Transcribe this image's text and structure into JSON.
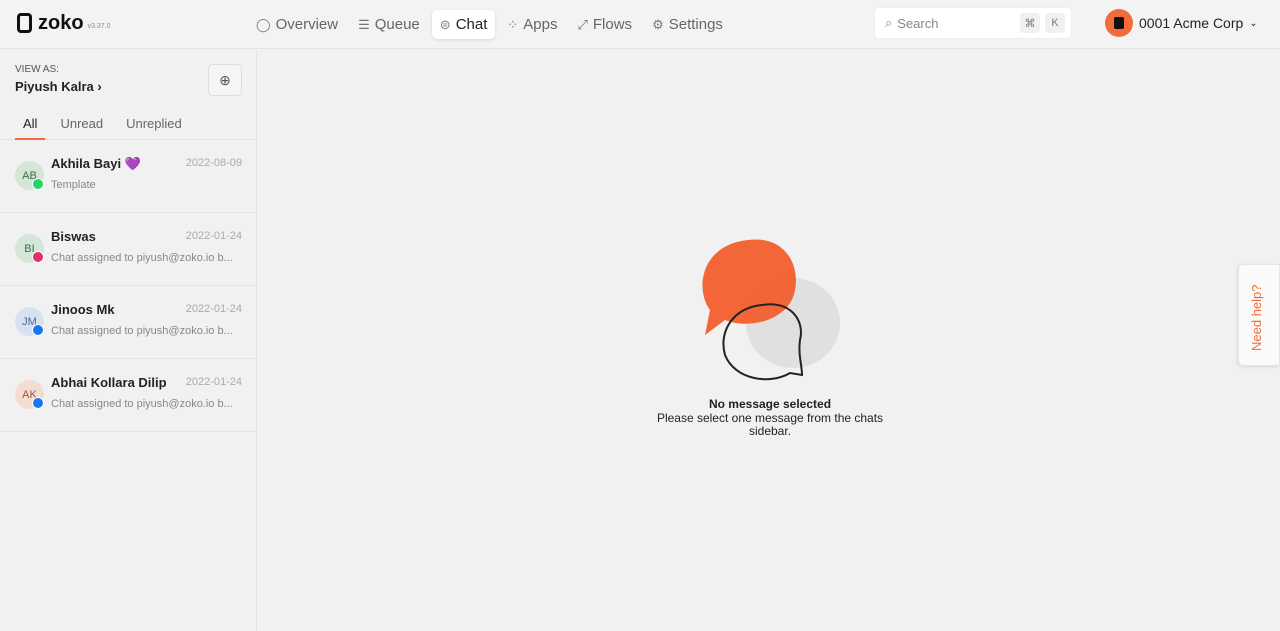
{
  "header": {
    "logo": "zoko",
    "version": "v3.37.0",
    "nav": [
      {
        "label": "Overview",
        "icon": "circle-icon"
      },
      {
        "label": "Queue",
        "icon": "queue-icon"
      },
      {
        "label": "Chat",
        "icon": "chat-icon",
        "active": true
      },
      {
        "label": "Apps",
        "icon": "apps-icon"
      },
      {
        "label": "Flows",
        "icon": "flows-icon"
      },
      {
        "label": "Settings",
        "icon": "gear-icon"
      }
    ],
    "search": {
      "placeholder": "Search",
      "key1": "⌘",
      "key2": "K"
    },
    "account": "0001 Acme Corp"
  },
  "sidebar": {
    "view_as_label": "VIEW AS:",
    "view_as_name": "Piyush Kalra",
    "tabs": [
      "All",
      "Unread",
      "Unreplied"
    ],
    "chats": [
      {
        "initials": "AB",
        "name": "Akhila Bayi 💜",
        "date": "2022-08-09",
        "preview": "Template",
        "channel": "whatsapp"
      },
      {
        "initials": "BI",
        "name": "Biswas",
        "date": "2022-01-24",
        "preview": "Chat assigned to piyush@zoko.io b...",
        "channel": "instagram"
      },
      {
        "initials": "JM",
        "name": "Jinoos Mk",
        "date": "2022-01-24",
        "preview": "Chat assigned to piyush@zoko.io b...",
        "channel": "facebook"
      },
      {
        "initials": "AK",
        "name": "Abhai Kollara Dilip",
        "date": "2022-01-24",
        "preview": "Chat assigned to piyush@zoko.io b...",
        "channel": "facebook"
      }
    ]
  },
  "main": {
    "empty_title": "No message selected",
    "empty_text": "Please select one message from the chats sidebar."
  },
  "help": "Need help?",
  "colors": {
    "accent": "#f36b3a"
  }
}
